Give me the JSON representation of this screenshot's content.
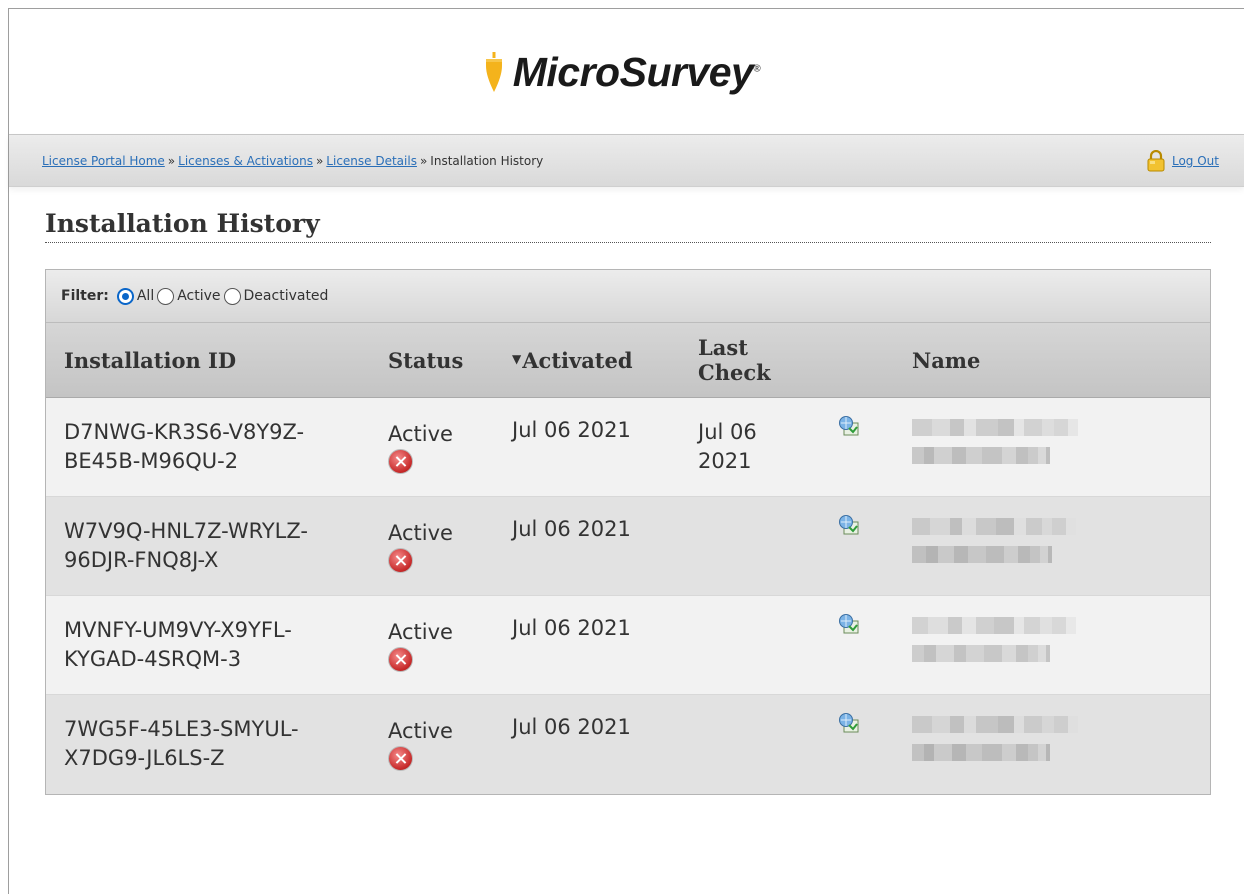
{
  "brand": {
    "name": "MicroSurvey",
    "registered_mark": "®",
    "accent_color": "#f4b31c"
  },
  "breadcrumb": {
    "items": [
      "License Portal Home",
      "Licenses & Activations",
      "License Details"
    ],
    "separator": "»",
    "current": "Installation History"
  },
  "logout": {
    "label": "Log Out",
    "icon": "padlock-icon"
  },
  "page": {
    "title": "Installation History"
  },
  "filter": {
    "label": "Filter:",
    "options": [
      "All",
      "Active",
      "Deactivated"
    ],
    "selected": "All"
  },
  "table": {
    "headers": {
      "id": "Installation ID",
      "status": "Status",
      "activated": "Activated",
      "last_check_1": "Last",
      "last_check_2": "Check",
      "name": "Name"
    },
    "sort": {
      "column": "Activated",
      "direction": "descending"
    },
    "rows": [
      {
        "id_1": "D7NWG-KR3S6-V8Y9Z-",
        "id_2": "BE45B-M96QU-2",
        "status": "Active",
        "activated": "Jul 06 2021",
        "last_check_1": "Jul 06",
        "last_check_2": "2021"
      },
      {
        "id_1": "W7V9Q-HNL7Z-WRYLZ-",
        "id_2": "96DJR-FNQ8J-X",
        "status": "Active",
        "activated": "Jul 06 2021",
        "last_check_1": "",
        "last_check_2": ""
      },
      {
        "id_1": "MVNFY-UM9VY-X9YFL-",
        "id_2": "KYGAD-4SRQM-3",
        "status": "Active",
        "activated": "Jul 06 2021",
        "last_check_1": "",
        "last_check_2": ""
      },
      {
        "id_1": "7WG5F-45LE3-SMYUL-",
        "id_2": "X7DG9-JL6LS-Z",
        "status": "Active",
        "activated": "Jul 06 2021",
        "last_check_1": "",
        "last_check_2": ""
      }
    ],
    "row_icons": {
      "deactivate": "red-x-deactivate-icon",
      "edit_name": "globe-rename-icon"
    }
  }
}
